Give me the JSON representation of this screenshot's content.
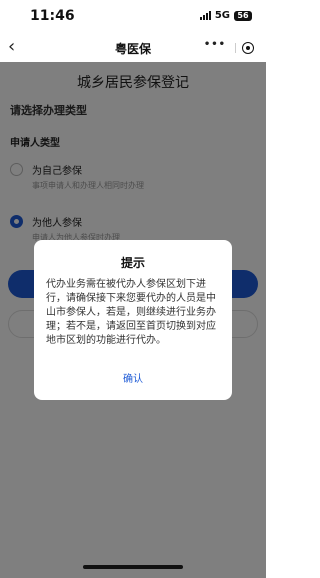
{
  "status_bar": {
    "time": "11:46",
    "network": "5G",
    "battery": "56"
  },
  "nav": {
    "title": "粤医保",
    "more": "•••"
  },
  "page": {
    "title": "城乡居民参保登记",
    "section_title": "请选择办理类型",
    "sub_title": "申请人类型",
    "options": [
      {
        "label": "为自己参保",
        "desc": "事项申请人和办理人相同时办理",
        "selected": false
      },
      {
        "label": "为他人参保",
        "desc": "申请人为他人参保时办理",
        "selected": true
      }
    ]
  },
  "dialog": {
    "title": "提示",
    "message": "代办业务需在被代办人参保区划下进行，请确保接下来您要代办的人员是中山市参保人，若是，则继续进行业务办理；若不是，请返回至首页切换到对应地市区划的功能进行代办。",
    "confirm_label": "确认"
  },
  "colors": {
    "accent": "#1e5bd6",
    "mask": "rgba(0,0,0,0.5)"
  }
}
